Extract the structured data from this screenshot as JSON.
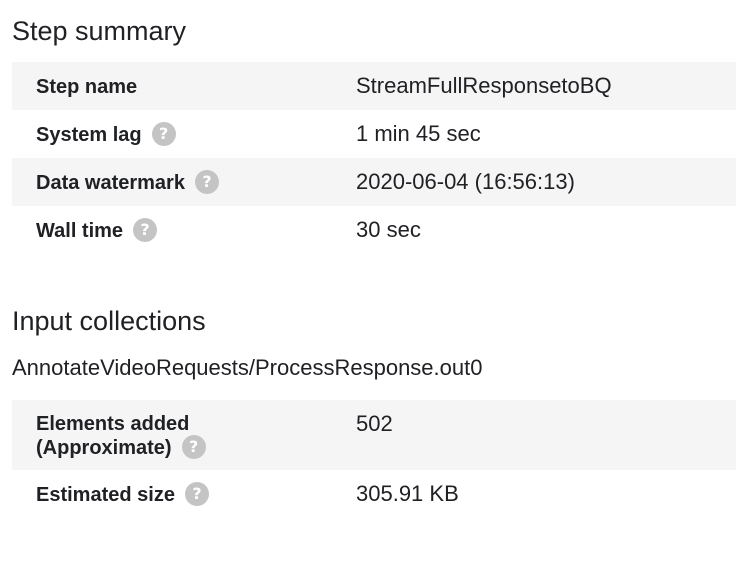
{
  "step_summary": {
    "title": "Step summary",
    "rows": [
      {
        "label": "Step name",
        "value": "StreamFullResponsetoBQ"
      },
      {
        "label": "System lag",
        "value": "1 min 45 sec"
      },
      {
        "label": "Data watermark",
        "value": "2020-06-04 (16:56:13)"
      },
      {
        "label": "Wall time",
        "value": "30 sec"
      }
    ]
  },
  "input_collections": {
    "title": "Input collections",
    "collection_name": "AnnotateVideoRequests/ProcessResponse.out0",
    "rows": [
      {
        "label_line1": "Elements added",
        "label_line2": "(Approximate)",
        "value": "502"
      },
      {
        "label": "Estimated size",
        "value": "305.91 KB"
      }
    ]
  },
  "icons": {
    "help": "help-circle-icon",
    "help_glyph": "?"
  },
  "colors": {
    "row_shade": "#f5f5f5",
    "help_icon_bg": "#c4c4c4",
    "text": "#202124"
  }
}
